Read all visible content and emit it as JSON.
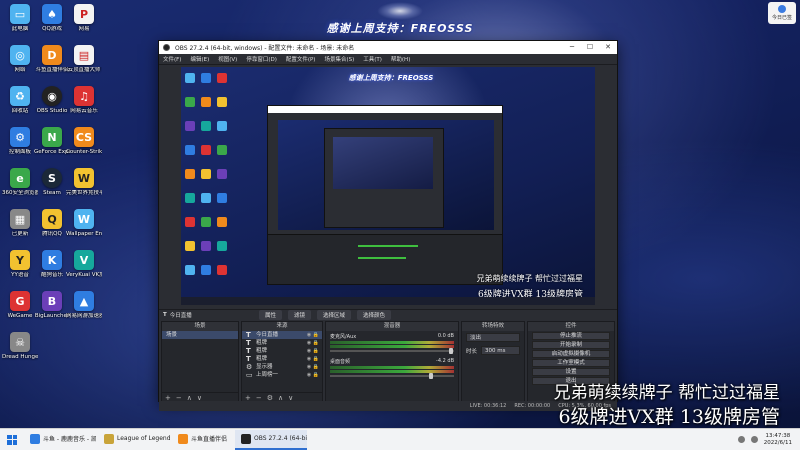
{
  "banner": {
    "text": "感谢上周支持：FREOSSS"
  },
  "captions": {
    "line1": "兄弟萌续续牌子  帮忙过过福星",
    "line2": "6级牌进VX群  13级牌房管"
  },
  "top_right_widget": {
    "label": "今日已签"
  },
  "desktop_icons": [
    {
      "label": "此电脑",
      "glyph": "▭",
      "color": "c-sky"
    },
    {
      "label": "QQ游戏",
      "glyph": "♠",
      "color": "c-blue"
    },
    {
      "label": "网易",
      "glyph": "P",
      "color": "c-file"
    },
    {
      "label": "网络",
      "glyph": "◎",
      "color": "c-sky"
    },
    {
      "label": "斗鱼直播伴侣",
      "glyph": "D",
      "color": "c-orange"
    },
    {
      "label": "云顶直播大师",
      "glyph": "▤",
      "color": "c-file"
    },
    {
      "label": "回收站",
      "glyph": "♻",
      "color": "c-sky"
    },
    {
      "label": "OBS Studio",
      "glyph": "◉",
      "color": "c-dark"
    },
    {
      "label": "网易云音乐",
      "glyph": "♫",
      "color": "c-red"
    },
    {
      "label": "控制面板",
      "glyph": "⚙",
      "color": "c-blue"
    },
    {
      "label": "GeForce Experience",
      "glyph": "N",
      "color": "c-green"
    },
    {
      "label": "Counter-Strike",
      "glyph": "CS",
      "color": "c-orange"
    },
    {
      "label": "360安全浏览器",
      "glyph": "e",
      "color": "c-green"
    },
    {
      "label": "Steam",
      "glyph": "S",
      "color": "c-steam"
    },
    {
      "label": "完美世界竞技平台",
      "glyph": "W",
      "color": "c-yellow"
    },
    {
      "label": "已更新",
      "glyph": "▦",
      "color": "c-grey"
    },
    {
      "label": "腾讯QQ",
      "glyph": "Q",
      "color": "c-yellow"
    },
    {
      "label": "Wallpaper Engine",
      "glyph": "W",
      "color": "c-sky"
    },
    {
      "label": "YY语音",
      "glyph": "Y",
      "color": "c-yellow"
    },
    {
      "label": "酷狗音乐",
      "glyph": "K",
      "color": "c-blue"
    },
    {
      "label": "VeryKuai VK加速器",
      "glyph": "V",
      "color": "c-teal"
    },
    {
      "label": "WeGame",
      "glyph": "G",
      "color": "c-red"
    },
    {
      "label": "BigLauncher",
      "glyph": "B",
      "color": "c-purple"
    },
    {
      "label": "网易网游加速器",
      "glyph": "▲",
      "color": "c-blue"
    },
    {
      "label": "Dread Hunger",
      "glyph": "☠",
      "color": "c-grey"
    }
  ],
  "obs": {
    "title": "OBS 27.2.4 (64-bit, windows) - 配置文件: 未命名 - 场景: 未命名",
    "menu": [
      "文件(F)",
      "编辑(E)",
      "视图(V)",
      "停靠窗口(D)",
      "配置文件(P)",
      "场景集合(S)",
      "工具(T)",
      "帮助(H)"
    ],
    "preview_banner": "感谢上周支持：FREOSSS",
    "nested_caption1": "兄弟萌续续牌子  帮忙过过福星",
    "nested_caption2": "6级牌进VX群  13级牌房管",
    "scene_name": "今日直播",
    "tab_buttons": [
      "属性",
      "滤镜",
      "选择区域",
      "选择颜色"
    ],
    "docks": {
      "scenes_title": "场景",
      "scenes": [
        "场景"
      ],
      "sources_title": "来源",
      "sources": [
        {
          "icon": "T",
          "name": "今日直播"
        },
        {
          "icon": "T",
          "name": "粗牌"
        },
        {
          "icon": "T",
          "name": "粗牌"
        },
        {
          "icon": "T",
          "name": "粗牌"
        },
        {
          "icon": "⚙",
          "name": "显示器"
        },
        {
          "icon": "▭",
          "name": "上周榜一"
        }
      ],
      "mixer_title": "混音器",
      "mixer": [
        {
          "name": "麦克风/Aux",
          "db": "0.0 dB"
        },
        {
          "name": "桌面音频",
          "db": "-4.2 dB"
        }
      ],
      "transitions_title": "转场特效",
      "transition": "淡出",
      "duration_label": "时长",
      "duration": "300 ms",
      "controls_title": "控件",
      "controls": [
        "停止推流",
        "开始录制",
        "启动虚拟摄像机",
        "工作室模式",
        "设置",
        "退出"
      ]
    },
    "status": [
      "LIVE: 00:36:12",
      "REC: 00:00:00",
      "CPU: 5.3%, 60.00 fps"
    ]
  },
  "taskbar": {
    "items": [
      {
        "label": "斗鱼 - 鹿鹿音乐 - 凯利...",
        "color": "#2f7de1",
        "active": false
      },
      {
        "label": "League of Legends",
        "color": "#c9a43a",
        "active": false
      },
      {
        "label": "斗鱼直播伴侣",
        "color": "#f08a1c",
        "active": false
      },
      {
        "label": "OBS 27.2.4 (64-bit...",
        "color": "#222222",
        "active": true
      }
    ],
    "time": "13:47:38",
    "date": "2022/6/11"
  }
}
